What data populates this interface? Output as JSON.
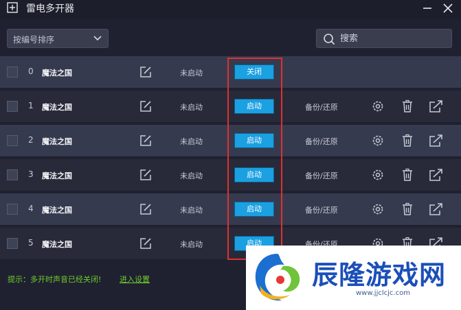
{
  "window": {
    "title": "雷电多开器"
  },
  "toolbar": {
    "sort_label": "按编号排序",
    "search_placeholder": "搜索"
  },
  "rows": [
    {
      "index": "0",
      "name": "魔法之国",
      "status": "未启动",
      "action": "关闭",
      "backup": ""
    },
    {
      "index": "1",
      "name": "魔法之国",
      "status": "未启动",
      "action": "启动",
      "backup": "备份/还原"
    },
    {
      "index": "2",
      "name": "魔法之国",
      "status": "未启动",
      "action": "启动",
      "backup": "备份/还原"
    },
    {
      "index": "3",
      "name": "魔法之国",
      "status": "未启动",
      "action": "启动",
      "backup": "备份/还原"
    },
    {
      "index": "4",
      "name": "魔法之国",
      "status": "未启动",
      "action": "启动",
      "backup": "备份/还原"
    },
    {
      "index": "5",
      "name": "魔法之国",
      "status": "未启动",
      "action": "启动",
      "backup": "备份/还原"
    }
  ],
  "footer": {
    "tip": "提示：多开时声音已经关闭!",
    "settings_link": "进入设置"
  },
  "watermark": {
    "title": "辰隆游戏网",
    "url": "www.jjclcjc.com"
  },
  "colors": {
    "accent": "#1ba0e2",
    "highlight": "#e0312e",
    "tip": "#6fcb2c",
    "row_light": "#363a4f",
    "row_dark": "#282a3a"
  }
}
